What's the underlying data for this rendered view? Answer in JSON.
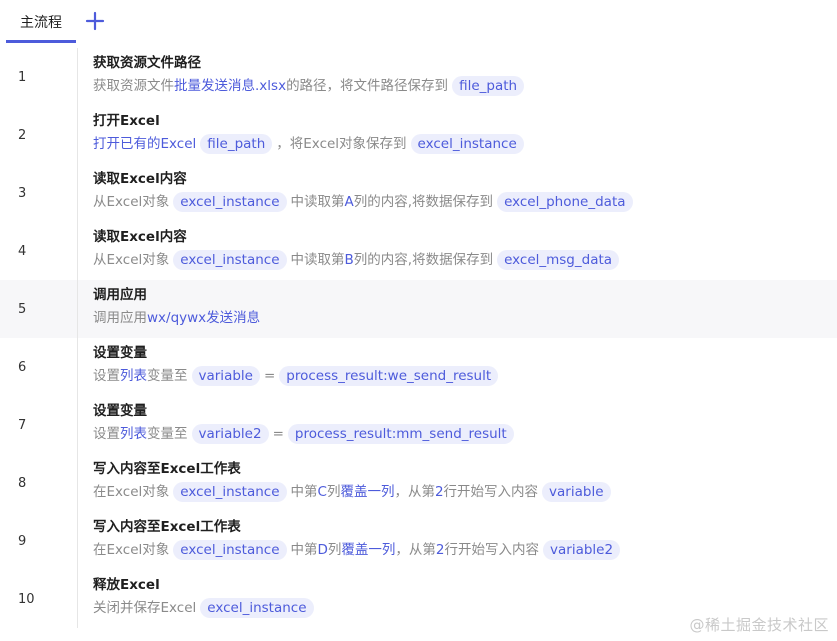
{
  "tabs": {
    "main_label": "主流程",
    "add_icon": "plus-icon"
  },
  "steps": [
    {
      "num": "1",
      "title": "获取资源文件路径",
      "desc": [
        {
          "t": "text",
          "v": "获取资源文件"
        },
        {
          "t": "link",
          "v": "批量发送消息.xlsx"
        },
        {
          "t": "text",
          "v": "的路径，将文件路径保存到"
        },
        {
          "t": "pill",
          "v": "file_path"
        }
      ]
    },
    {
      "num": "2",
      "title": "打开Excel",
      "desc": [
        {
          "t": "link",
          "v": "打开已有的Excel"
        },
        {
          "t": "pill",
          "v": "file_path"
        },
        {
          "t": "text",
          "v": "，将Excel对象保存到"
        },
        {
          "t": "pill",
          "v": "excel_instance"
        }
      ]
    },
    {
      "num": "3",
      "title": "读取Excel内容",
      "desc": [
        {
          "t": "text",
          "v": "从Excel对象"
        },
        {
          "t": "pill",
          "v": "excel_instance"
        },
        {
          "t": "text",
          "v": "中读取第"
        },
        {
          "t": "link",
          "v": "A"
        },
        {
          "t": "text",
          "v": "列的内容,将数据保存到"
        },
        {
          "t": "pill",
          "v": "excel_phone_data"
        }
      ]
    },
    {
      "num": "4",
      "title": "读取Excel内容",
      "desc": [
        {
          "t": "text",
          "v": "从Excel对象"
        },
        {
          "t": "pill",
          "v": "excel_instance"
        },
        {
          "t": "text",
          "v": "中读取第"
        },
        {
          "t": "link",
          "v": "B"
        },
        {
          "t": "text",
          "v": "列的内容,将数据保存到"
        },
        {
          "t": "pill",
          "v": "excel_msg_data"
        }
      ]
    },
    {
      "num": "5",
      "title": "调用应用",
      "highlight": true,
      "desc": [
        {
          "t": "text",
          "v": "调用应用"
        },
        {
          "t": "link",
          "v": "wx/qywx发送消息"
        }
      ]
    },
    {
      "num": "6",
      "title": "设置变量",
      "desc": [
        {
          "t": "text",
          "v": "设置"
        },
        {
          "t": "link",
          "v": "列表"
        },
        {
          "t": "text",
          "v": "变量至"
        },
        {
          "t": "pill",
          "v": "variable"
        },
        {
          "t": "text",
          "v": "="
        },
        {
          "t": "pill",
          "v": "process_result:we_send_result"
        }
      ]
    },
    {
      "num": "7",
      "title": "设置变量",
      "desc": [
        {
          "t": "text",
          "v": "设置"
        },
        {
          "t": "link",
          "v": "列表"
        },
        {
          "t": "text",
          "v": "变量至"
        },
        {
          "t": "pill",
          "v": "variable2"
        },
        {
          "t": "text",
          "v": "="
        },
        {
          "t": "pill",
          "v": "process_result:mm_send_result"
        }
      ]
    },
    {
      "num": "8",
      "title": "写入内容至Excel工作表",
      "desc": [
        {
          "t": "text",
          "v": "在Excel对象"
        },
        {
          "t": "pill",
          "v": "excel_instance"
        },
        {
          "t": "text",
          "v": "中第"
        },
        {
          "t": "link",
          "v": "C"
        },
        {
          "t": "text",
          "v": "列"
        },
        {
          "t": "link",
          "v": "覆盖一列"
        },
        {
          "t": "text",
          "v": "，从第"
        },
        {
          "t": "link",
          "v": "2"
        },
        {
          "t": "text",
          "v": "行开始写入内容"
        },
        {
          "t": "pill",
          "v": "variable"
        }
      ]
    },
    {
      "num": "9",
      "title": "写入内容至Excel工作表",
      "desc": [
        {
          "t": "text",
          "v": "在Excel对象"
        },
        {
          "t": "pill",
          "v": "excel_instance"
        },
        {
          "t": "text",
          "v": "中第"
        },
        {
          "t": "link",
          "v": "D"
        },
        {
          "t": "text",
          "v": "列"
        },
        {
          "t": "link",
          "v": "覆盖一列"
        },
        {
          "t": "text",
          "v": "，从第"
        },
        {
          "t": "link",
          "v": "2"
        },
        {
          "t": "text",
          "v": "行开始写入内容"
        },
        {
          "t": "pill",
          "v": "variable2"
        }
      ]
    },
    {
      "num": "10",
      "title": "释放Excel",
      "desc": [
        {
          "t": "text",
          "v": "关闭并保存Excel"
        },
        {
          "t": "pill",
          "v": "excel_instance"
        }
      ]
    }
  ],
  "watermark": "@稀土掘金技术社区",
  "colors": {
    "accent": "#4d5bdb",
    "pill_bg": "#eceefc",
    "muted_text": "#8a8a8a"
  }
}
